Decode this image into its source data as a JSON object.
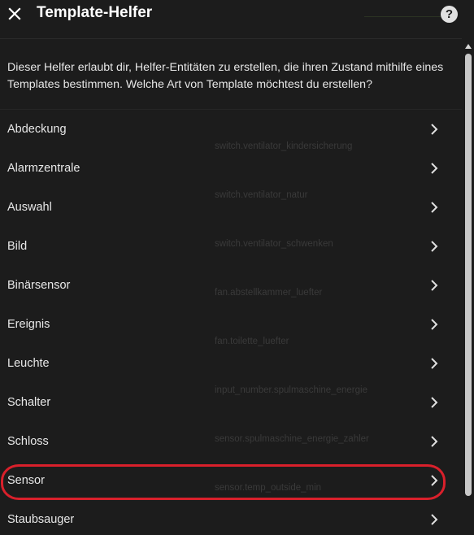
{
  "dialog": {
    "title": "Template-Helfer",
    "close_icon": "close-icon",
    "help_icon": "help-circle-icon",
    "help_glyph": "?"
  },
  "description": "Dieser Helfer erlaubt dir, Helfer-Entitäten zu erstellen, die ihren Zustand mithilfe eines Templates bestimmen. Welche Art von Template möchtest du erstellen?",
  "template_types": [
    {
      "label": "Abdeckung"
    },
    {
      "label": "Alarmzentrale"
    },
    {
      "label": "Auswahl"
    },
    {
      "label": "Bild"
    },
    {
      "label": "Binärsensor"
    },
    {
      "label": "Ereignis"
    },
    {
      "label": "Leuchte"
    },
    {
      "label": "Schalter"
    },
    {
      "label": "Schloss"
    },
    {
      "label": "Sensor",
      "highlighted": true
    },
    {
      "label": "Staubsauger"
    }
  ],
  "background_entities": [
    "switch.ventilator_kindersicherung",
    "switch.ventilator_natur",
    "switch.ventilator_schwenken",
    "fan.abstellkammer_luefter",
    "fan.toilette_luefter",
    "input_number.spulmaschine_energie",
    "sensor.spulmaschine_energie_zahler",
    "sensor.temp_outside_min"
  ],
  "colors": {
    "background": "#1c1c1c",
    "text": "#e1e1e1",
    "highlight_ring": "#d9202b"
  }
}
